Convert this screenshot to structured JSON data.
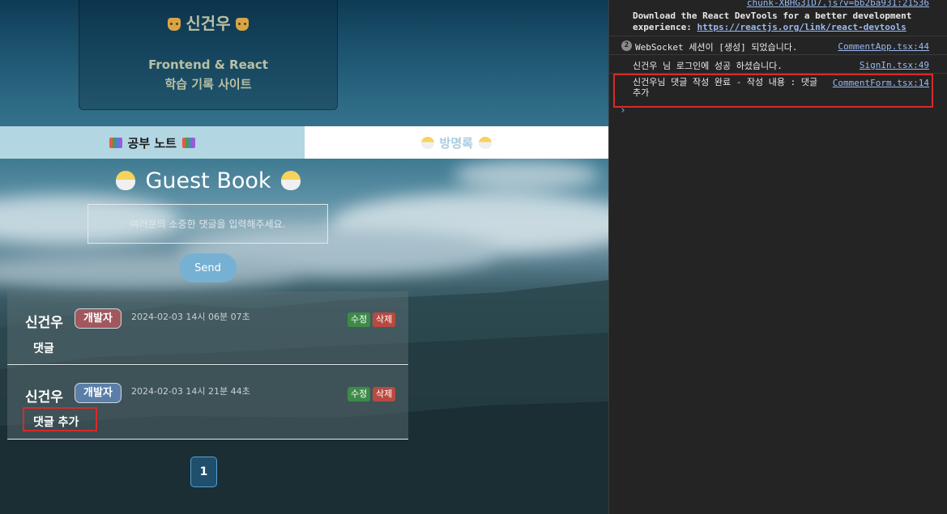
{
  "header": {
    "name": "신건우",
    "line1": "Frontend & React",
    "line2": "학습 기록 사이트"
  },
  "tabs": {
    "notes": "공부 노트",
    "guestbook": "방명록"
  },
  "guestbook": {
    "title": "Guest Book",
    "placeholder": "여러분의 소중한 댓글을 입력해주세요.",
    "send_label": "Send"
  },
  "comments": [
    {
      "author": "신건우",
      "badge": "개발자",
      "date": "2024-02-03 14시 06분 07초",
      "edit_label": "수정",
      "delete_label": "삭제",
      "body": "댓글"
    },
    {
      "author": "신건우",
      "badge": "개발자",
      "date": "2024-02-03 14시 21분 44초",
      "edit_label": "수정",
      "delete_label": "삭제",
      "body": "댓글 추가"
    }
  ],
  "pagination": {
    "current": "1"
  },
  "console": {
    "top_source": "chunk-XBHG3ID7.js?v=bb2ba931:21536",
    "devtools_text": "Download the React DevTools for a better development experience: ",
    "devtools_link": "https://reactjs.org/link/react-devtools",
    "logs": [
      {
        "count": "2",
        "text": "WebSocket 세션이 [생성] 되었습니다.",
        "source": "CommentApp.tsx:44"
      },
      {
        "text": "신건우 님 로그인에 성공 하셨습니다.",
        "source": "SignIn.tsx:49"
      },
      {
        "text": "신건우님 댓글 작성 완료 - 작성 내용 : 댓글 추가",
        "source": "CommentForm.tsx:14"
      }
    ]
  }
}
